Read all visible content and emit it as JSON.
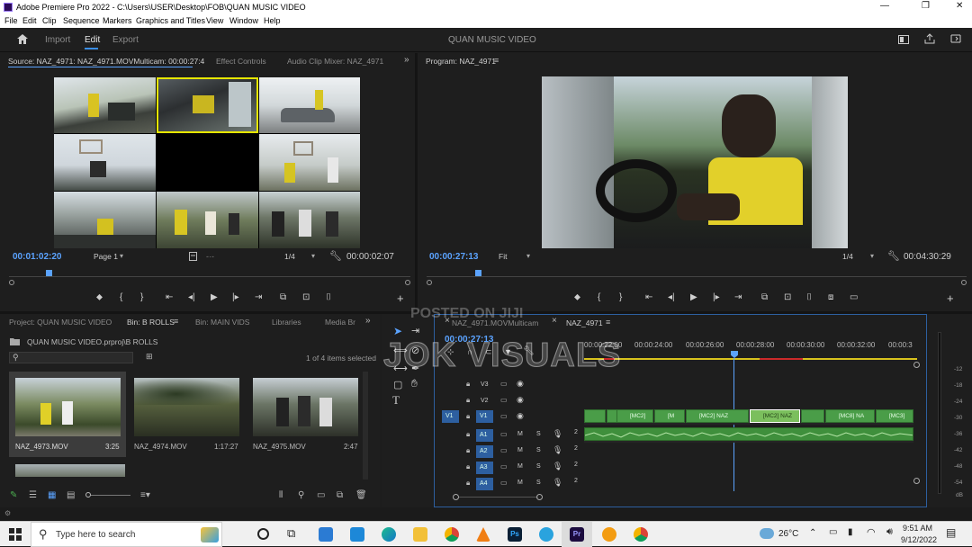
{
  "window": {
    "title": "Adobe Premiere Pro 2022 - C:\\Users\\USER\\Desktop\\FOB\\QUAN MUSIC VIDEO",
    "controls": [
      "—",
      "❐",
      "✕"
    ]
  },
  "menu": [
    "File",
    "Edit",
    "Clip",
    "Sequence",
    "Markers",
    "Graphics and Titles",
    "View",
    "Window",
    "Help"
  ],
  "header": {
    "workspaces": [
      "Import",
      "Edit",
      "Export"
    ],
    "active_workspace": "Edit",
    "project_title": "QUAN MUSIC VIDEO"
  },
  "source_monitor": {
    "tabs": [
      "Source: NAZ_4971: NAZ_4971.MOVMulticam: 00:00:27:4",
      "Effect Controls",
      "Audio Clip Mixer: NAZ_4971"
    ],
    "timecode_left": "00:01:02:20",
    "page": "Page 1",
    "fraction": "1/4",
    "timecode_right": "00:00:02:07"
  },
  "program_monitor": {
    "tab": "Program: NAZ_4971",
    "timecode_left": "00:00:27:13",
    "zoom": "Fit",
    "fraction": "1/4",
    "timecode_right": "00:04:30:29"
  },
  "project_panel": {
    "tabs": [
      "Project: QUAN MUSIC VIDEO",
      "Bin: B ROLLS",
      "Bin: MAIN VIDS",
      "Libraries",
      "Media Br"
    ],
    "path": "QUAN MUSIC VIDEO.prproj\\B ROLLS",
    "selection": "1 of 4 items selected",
    "items": [
      {
        "name": "NAZ_4973.MOV",
        "duration": "3:25"
      },
      {
        "name": "NAZ_4974.MOV",
        "duration": "1:17:27"
      },
      {
        "name": "NAZ_4975.MOV",
        "duration": "2:47"
      }
    ]
  },
  "timeline": {
    "tabs": [
      "NAZ_4971.MOVMulticam",
      "NAZ_4971"
    ],
    "timecode": "00:00:27:13",
    "ruler": [
      "00:00:22:00",
      "00:00:24:00",
      "00:00:26:00",
      "00:00:28:00",
      "00:00:30:00",
      "00:00:32:00",
      "00:00:3"
    ],
    "video_tracks": [
      "V3",
      "V2",
      "V1"
    ],
    "audio_tracks": [
      "A1",
      "A2",
      "A3",
      "A4"
    ],
    "source_patch_v": "V1",
    "clips": [
      "",
      "[MC2]",
      "[M",
      "[MC2] NAZ",
      "[MC2] NAZ",
      "",
      "[MC8] NA",
      "[MC3]"
    ],
    "meter_ticks": [
      "-12",
      "-18",
      "-24",
      "-30",
      "-36",
      "-42",
      "-48",
      "-54",
      "dB"
    ],
    "audio_channel": "2"
  },
  "taskbar": {
    "search_placeholder": "Type here to search",
    "weather": "26°C",
    "time": "9:51 AM",
    "date": "9/12/2022"
  },
  "watermark": {
    "posted": "POSTED ON JIJI",
    "brand": "JOK VISUALS"
  }
}
